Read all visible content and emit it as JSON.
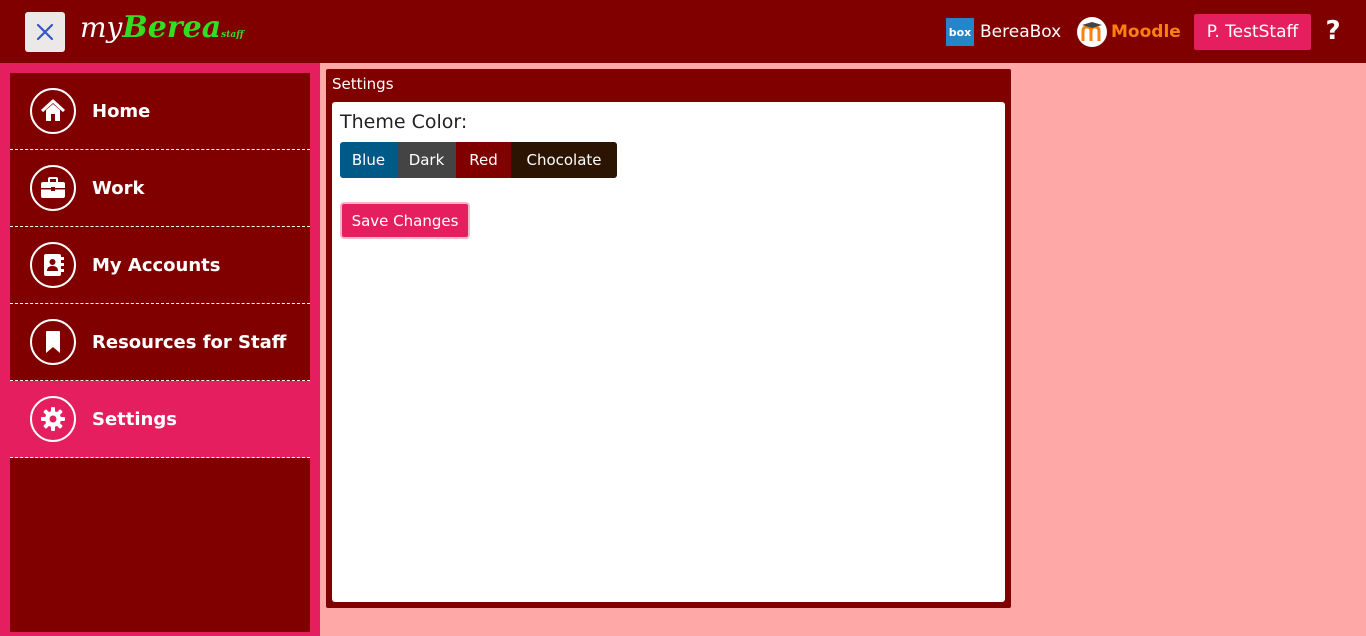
{
  "header": {
    "close_icon": "x-icon",
    "logo": {
      "my": "my",
      "berea": "Berea",
      "staff": "staff"
    },
    "links": {
      "bereabox": {
        "icon": "box",
        "label": "BereaBox"
      },
      "moodle": {
        "label": "Moodle"
      }
    },
    "user_label": "P. TestStaff",
    "help_label": "?"
  },
  "sidebar": {
    "items": [
      {
        "label": "Home",
        "icon": "home-icon"
      },
      {
        "label": "Work",
        "icon": "briefcase-icon"
      },
      {
        "label": "My Accounts",
        "icon": "address-book-icon"
      },
      {
        "label": "Resources for Staff",
        "icon": "bookmark-icon"
      },
      {
        "label": "Settings",
        "icon": "gear-icon",
        "active": true
      }
    ]
  },
  "settings": {
    "title": "Settings",
    "theme_label": "Theme Color:",
    "themes": [
      {
        "label": "Blue",
        "color": "#005a87"
      },
      {
        "label": "Dark",
        "color": "#444444"
      },
      {
        "label": "Red",
        "color": "#800000"
      },
      {
        "label": "Chocolate",
        "color": "#2c1402"
      }
    ],
    "save_label": "Save Changes"
  },
  "colors": {
    "header_bg": "#800000",
    "accent": "#e51e5f",
    "page_bg": "#ffa8a8",
    "logo_green": "#33dd22",
    "moodle_orange": "#f98012"
  }
}
